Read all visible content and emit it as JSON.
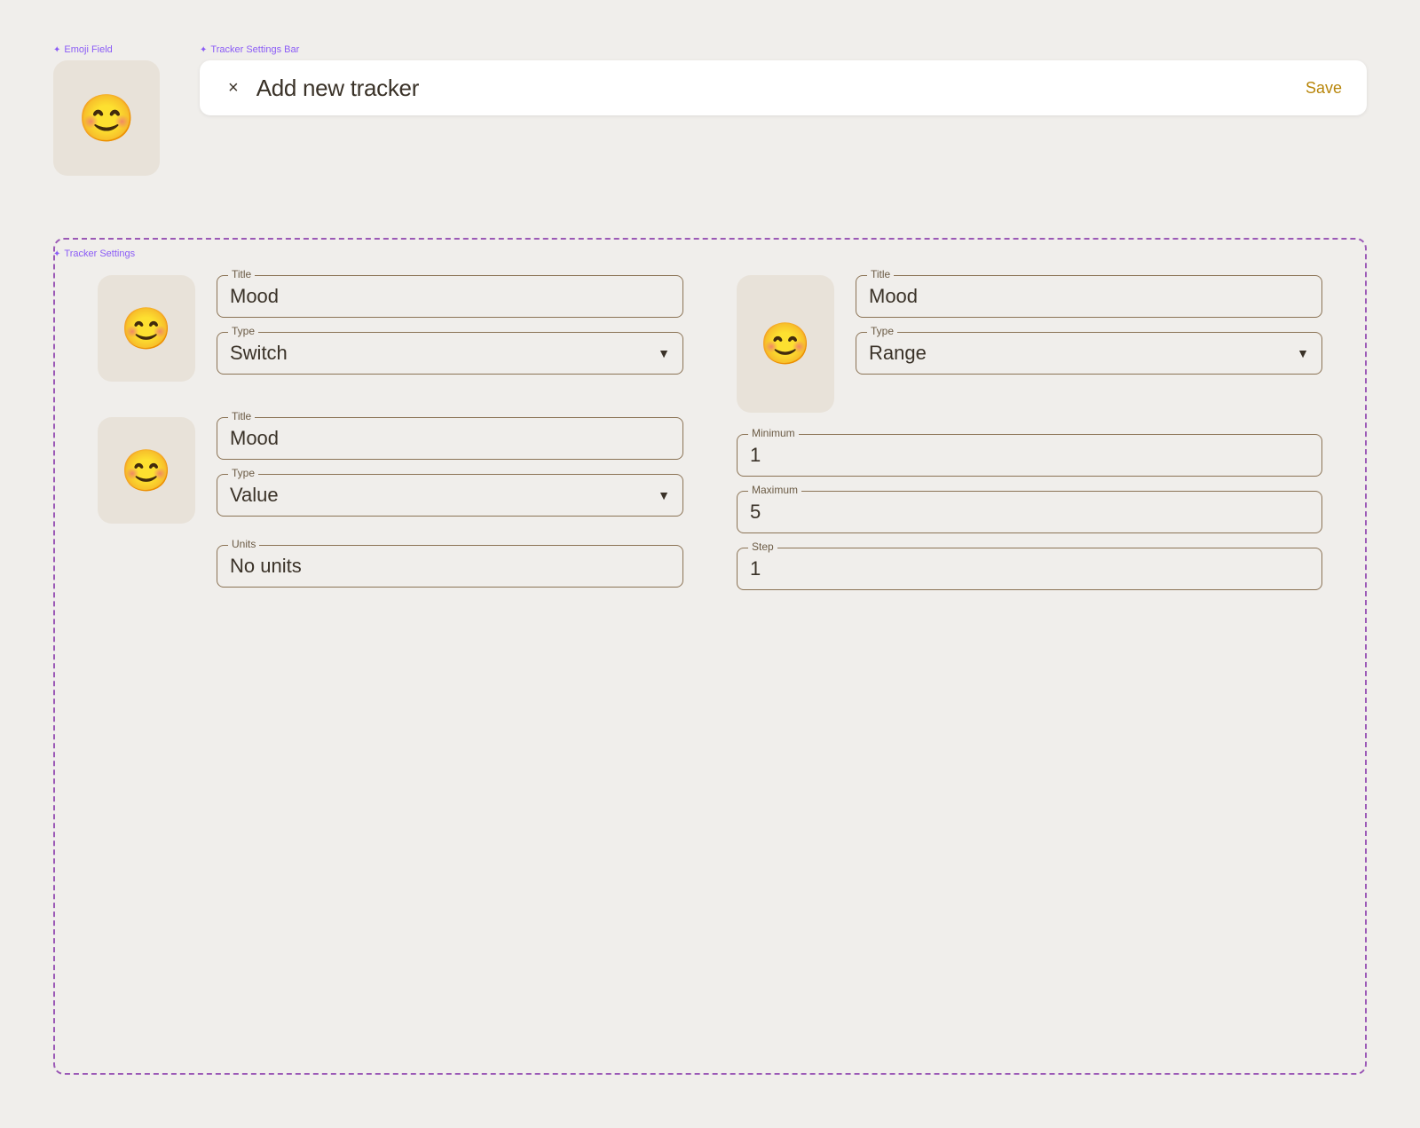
{
  "annotations": {
    "emoji_field_label": "Emoji Field",
    "tracker_settings_bar_label": "Tracker Settings Bar",
    "tracker_settings_label": "Tracker Settings"
  },
  "header": {
    "close_label": "×",
    "title": "Add new tracker",
    "save_label": "Save"
  },
  "emoji_top": "😊",
  "left_column": {
    "item1": {
      "emoji": "😊",
      "title_label": "Title",
      "title_value": "Mood",
      "type_label": "Type",
      "type_value": "Switch"
    },
    "item2": {
      "emoji": "😊",
      "title_label": "Title",
      "title_value": "Mood",
      "type_label": "Type",
      "type_value": "Value",
      "units_label": "Units",
      "units_value": "No units"
    }
  },
  "right_column": {
    "item1": {
      "emoji": "😊",
      "title_label": "Title",
      "title_value": "Mood",
      "type_label": "Type",
      "type_value": "Range"
    },
    "minimum_label": "Minimum",
    "minimum_value": "1",
    "maximum_label": "Maximum",
    "maximum_value": "5",
    "step_label": "Step",
    "step_value": "1"
  },
  "icons": {
    "close": "×",
    "dropdown_arrow": "▼",
    "annotation_star": "✦"
  }
}
